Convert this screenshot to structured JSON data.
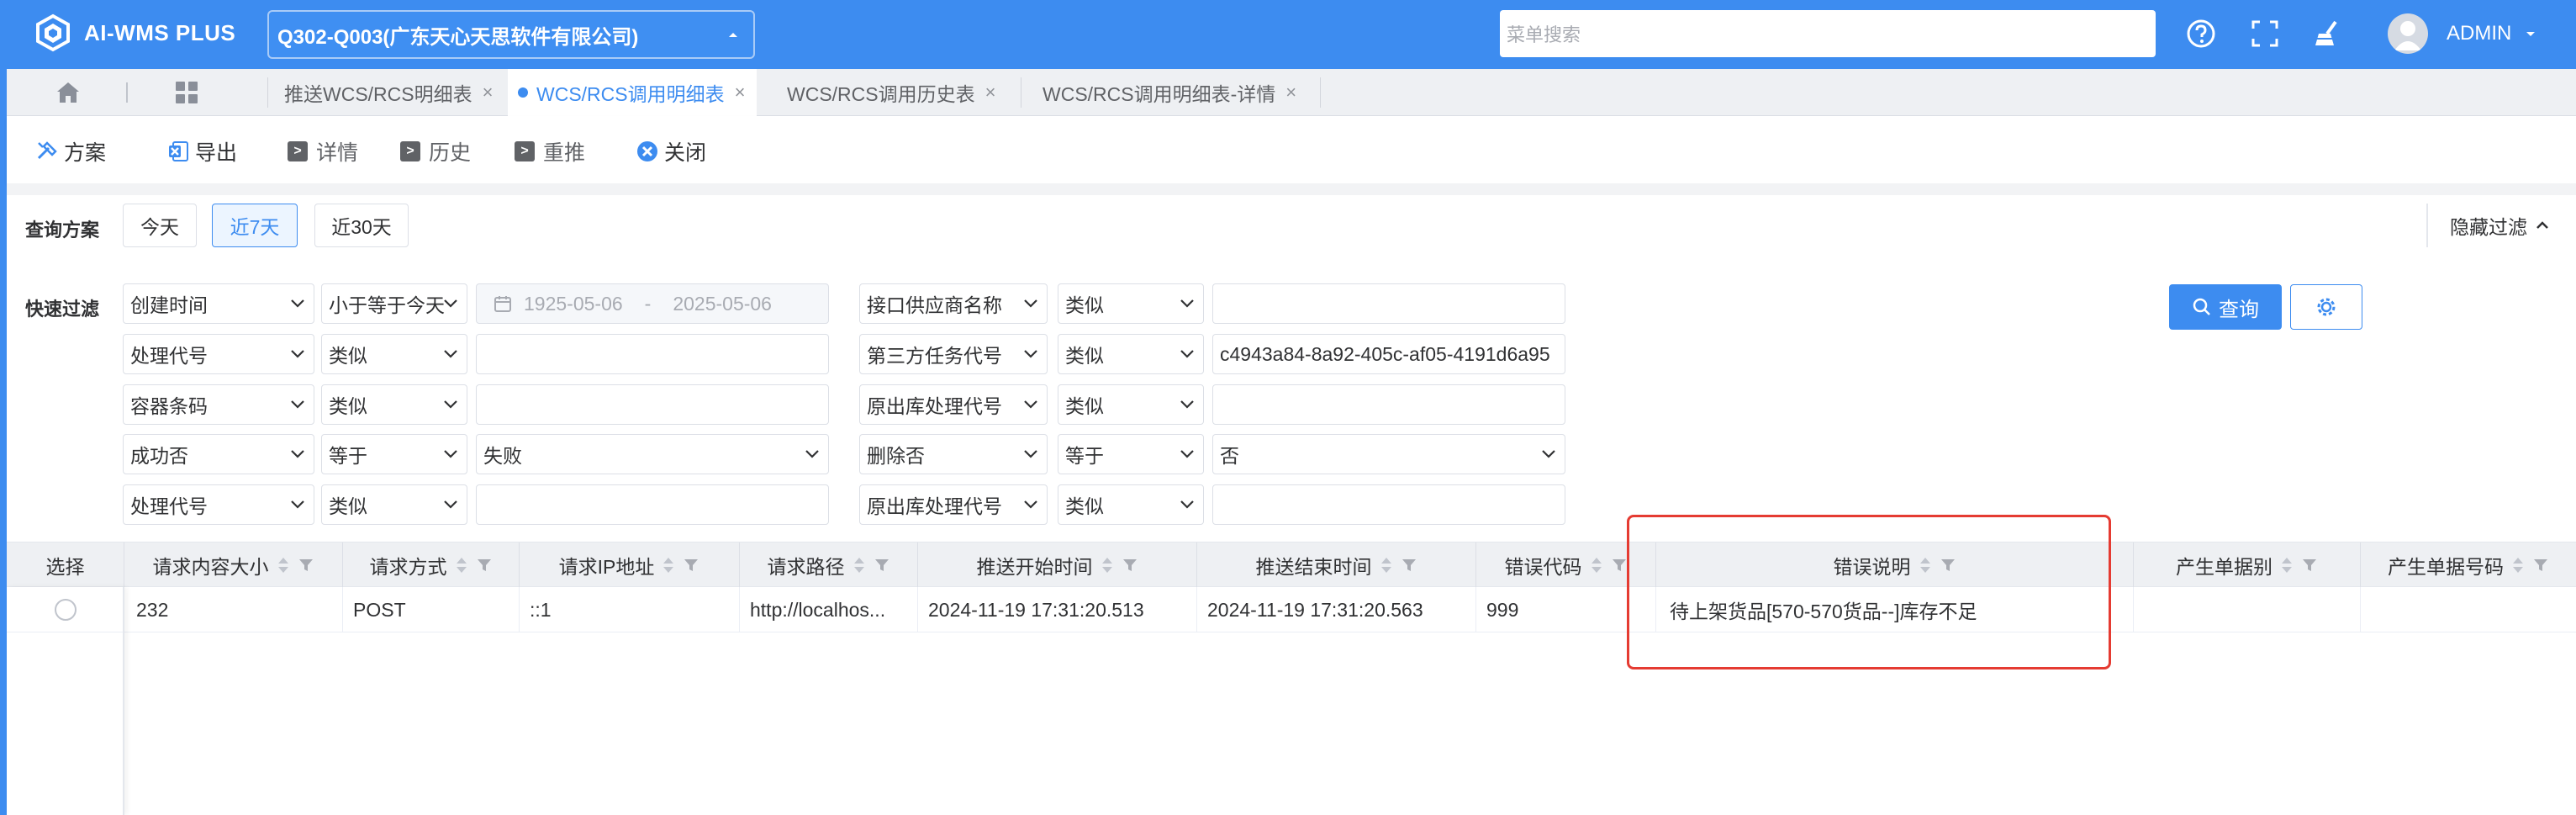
{
  "app": {
    "logo_text": "AI-WMS PLUS",
    "org_select": "Q302-Q003(广东天心天思软件有限公司)",
    "menu_search_placeholder": "菜单搜索",
    "user": "ADMIN"
  },
  "tabs": [
    {
      "label": "推送WCS/RCS明细表",
      "active": false
    },
    {
      "label": "WCS/RCS调用明细表",
      "active": true
    },
    {
      "label": "WCS/RCS调用历史表",
      "active": false
    },
    {
      "label": "WCS/RCS调用明细表-详情",
      "active": false
    }
  ],
  "toolbar": {
    "plan": "方案",
    "export": "导出",
    "detail": "详情",
    "history": "历史",
    "repush": "重推",
    "close": "关闭"
  },
  "query_plan": {
    "label": "查询方案",
    "options": [
      "今天",
      "近7天",
      "近30天"
    ],
    "selected": "近7天",
    "hide_filter": "隐藏过滤"
  },
  "quick_filter": {
    "label": "快速过滤",
    "left_rows": [
      {
        "field": "创建时间",
        "op": "小于等于今天",
        "value_start": "1925-05-06",
        "value_sep": "-",
        "value_end": "2025-05-06"
      },
      {
        "field": "处理代号",
        "op": "类似",
        "value": ""
      },
      {
        "field": "容器条码",
        "op": "类似",
        "value": ""
      },
      {
        "field": "成功否",
        "op": "等于",
        "value": "失败"
      },
      {
        "field": "处理代号",
        "op": "类似",
        "value": ""
      }
    ],
    "right_rows": [
      {
        "field": "接口供应商名称",
        "op": "类似",
        "value": ""
      },
      {
        "field": "第三方任务代号",
        "op": "类似",
        "value": "c4943a84-8a92-405c-af05-4191d6a95"
      },
      {
        "field": "原出库处理代号",
        "op": "类似",
        "value": ""
      },
      {
        "field": "删除否",
        "op": "等于",
        "value": "否"
      },
      {
        "field": "原出库处理代号",
        "op": "类似",
        "value": ""
      }
    ],
    "query_button": "查询"
  },
  "table": {
    "select_header": "选择",
    "columns": [
      "请求内容大小",
      "请求方式",
      "请求IP地址",
      "请求路径",
      "推送开始时间",
      "推送结束时间",
      "错误代码",
      "错误说明",
      "产生单据别",
      "产生单据号码"
    ],
    "rows": [
      [
        "232",
        "POST",
        "::1",
        "http://localhos...",
        "2024-11-19 17:31:20.513",
        "2024-11-19 17:31:20.563",
        "999",
        "待上架货品[570-570货品--]库存不足",
        "",
        ""
      ]
    ]
  },
  "colors": {
    "primary": "#3d8cf0",
    "highlight": "#e53b32"
  }
}
